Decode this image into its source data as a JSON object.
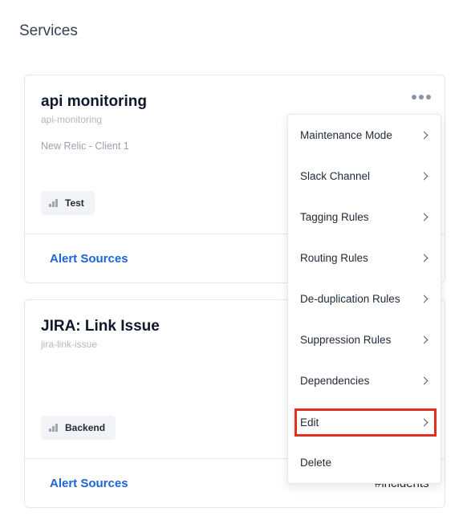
{
  "page": {
    "title": "Services"
  },
  "cards": [
    {
      "title": "api monitoring",
      "slug": "api-monitoring",
      "description": "New Relic - Client 1",
      "tag": "Test",
      "alert_sources_label": "Alert Sources"
    },
    {
      "title": "JIRA: Link Issue",
      "slug": "jira-link-issue",
      "description": "",
      "tag": "Backend",
      "alert_sources_label": "Alert Sources",
      "slack_channel": "#incidents"
    }
  ],
  "menu": {
    "items": [
      {
        "label": "Maintenance Mode",
        "has_submenu": true
      },
      {
        "label": "Slack Channel",
        "has_submenu": true
      },
      {
        "label": "Tagging Rules",
        "has_submenu": true
      },
      {
        "label": "Routing Rules",
        "has_submenu": true
      },
      {
        "label": "De-duplication Rules",
        "has_submenu": true
      },
      {
        "label": "Suppression Rules",
        "has_submenu": true
      },
      {
        "label": "Dependencies",
        "has_submenu": true
      },
      {
        "label": "Edit",
        "has_submenu": true,
        "highlighted": true
      },
      {
        "label": "Delete",
        "has_submenu": false
      }
    ]
  },
  "icons": {
    "more": "more-horizontal-icon",
    "tag": "signal-bars-icon",
    "chevron": "chevron-right-icon"
  },
  "colors": {
    "link": "#1d64d8",
    "highlight": "#e1301d"
  }
}
